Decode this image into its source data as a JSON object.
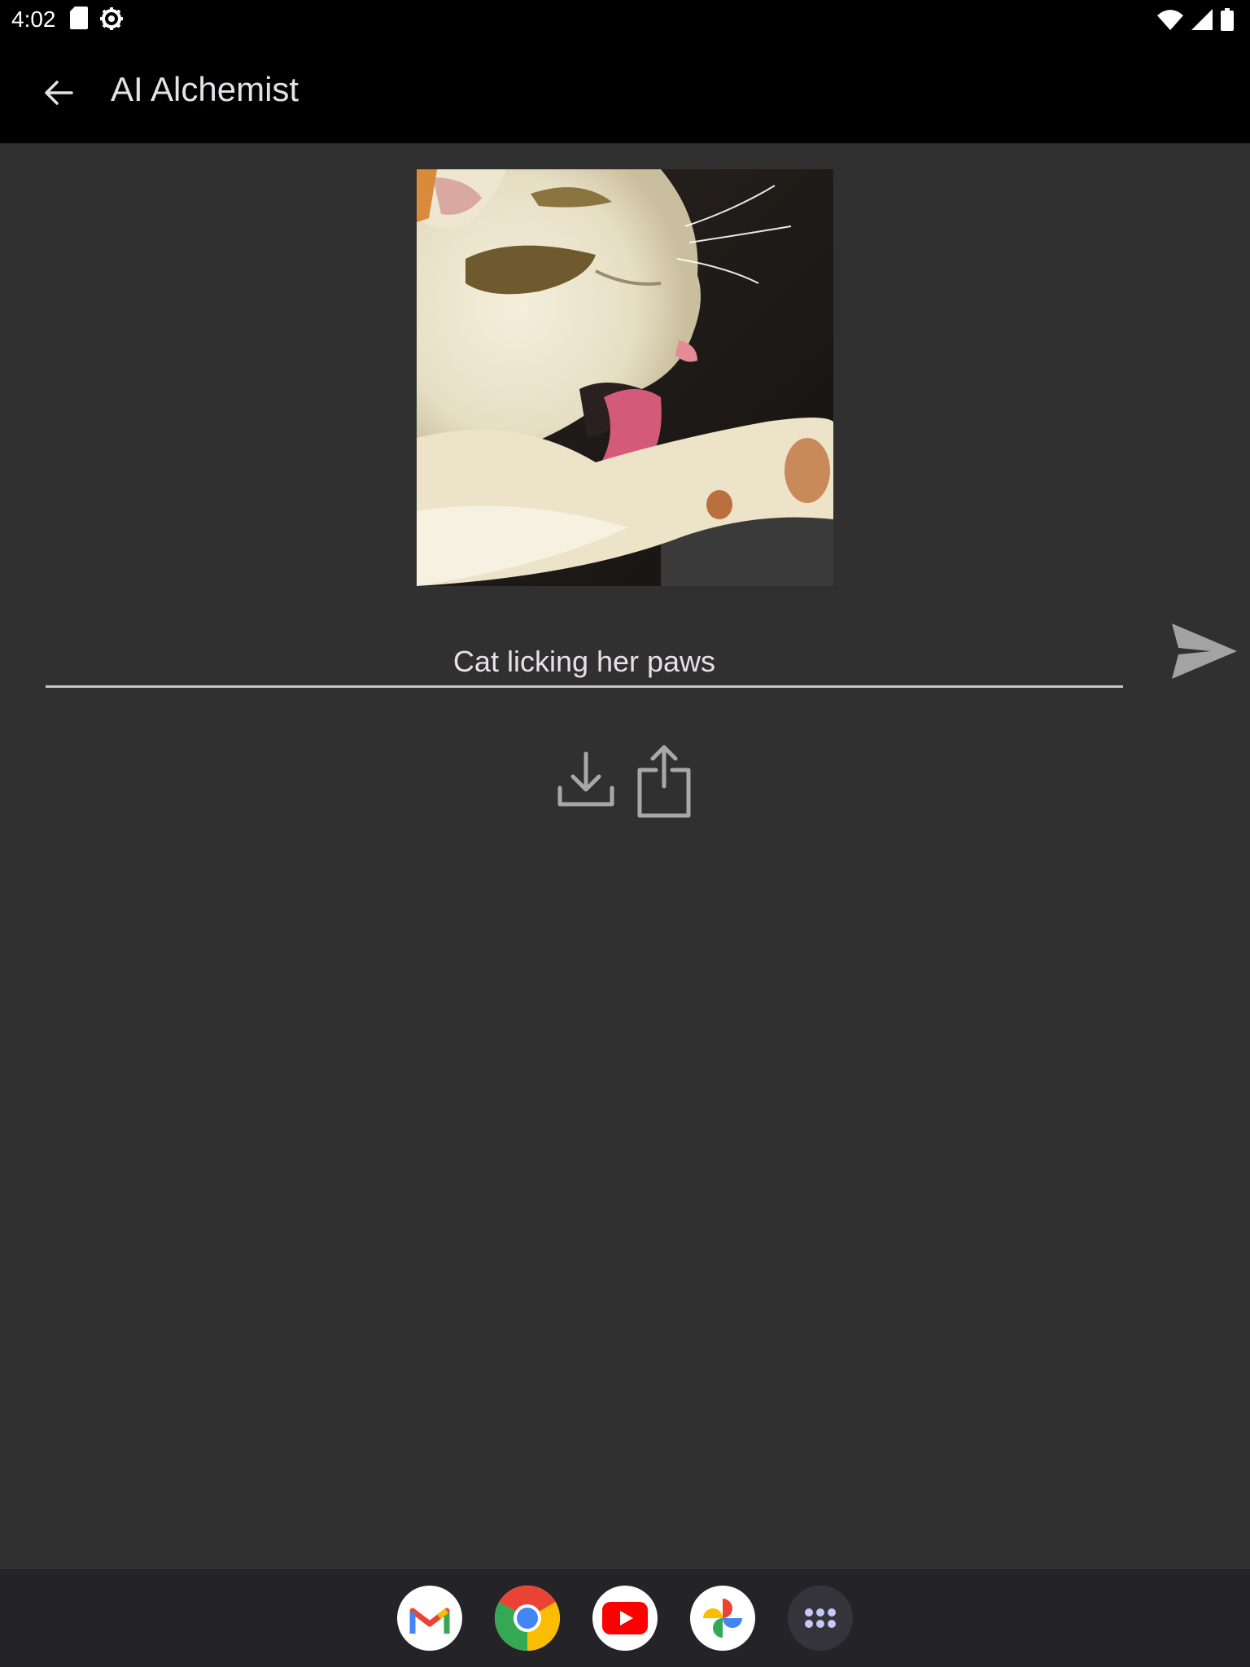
{
  "status_bar": {
    "time": "4:02",
    "left_icons": [
      "sd-card-icon",
      "settings-icon"
    ],
    "right_icons": [
      "wifi-icon",
      "signal-icon",
      "battery-icon"
    ]
  },
  "app_bar": {
    "title": "AI Alchemist",
    "back_icon": "arrow-back-icon"
  },
  "result": {
    "image": "generated-cat-image"
  },
  "prompt": {
    "value": "Cat licking her paws"
  },
  "actions": {
    "send_icon": "send-icon",
    "download_icon": "download-icon",
    "share_icon": "share-icon"
  },
  "dock": {
    "apps": [
      "gmail-icon",
      "chrome-icon",
      "youtube-icon",
      "photos-icon",
      "app-drawer-icon"
    ]
  },
  "colors": {
    "background": "#303030",
    "app_bar": "#000000",
    "underline": "#cac4d0",
    "dock": "#242428"
  }
}
